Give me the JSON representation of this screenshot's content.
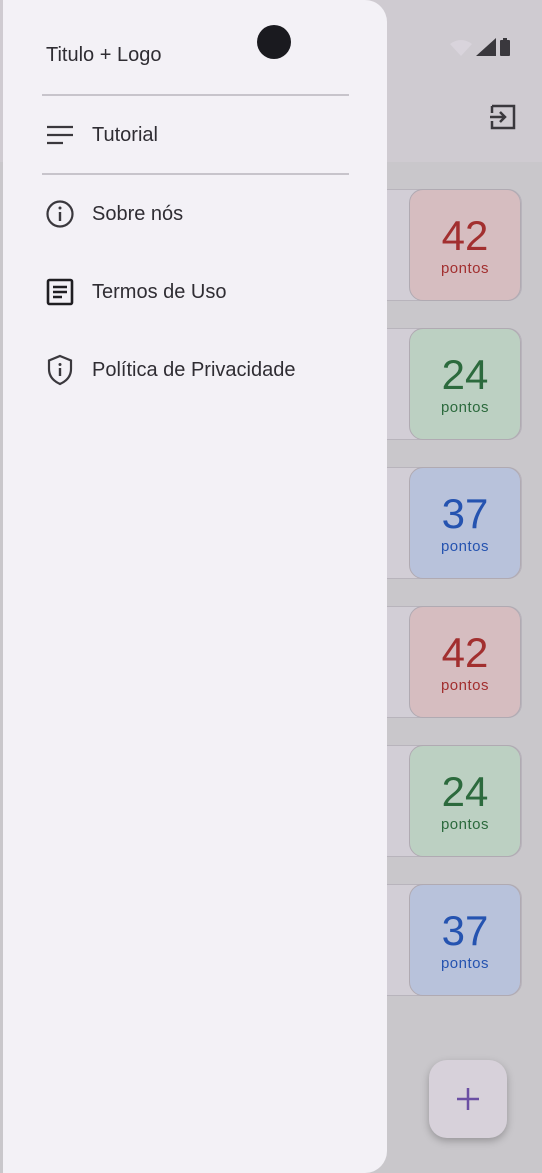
{
  "drawer": {
    "title": "Titulo + Logo",
    "items": [
      {
        "label": "Tutorial",
        "icon": "menu-lines-icon"
      },
      {
        "label": "Sobre nós",
        "icon": "info-icon"
      },
      {
        "label": "Termos de Uso",
        "icon": "document-icon"
      },
      {
        "label": "Política de Privacidade",
        "icon": "shield-info-icon"
      }
    ]
  },
  "cards": [
    {
      "value": "42",
      "unit": "pontos",
      "color": "red"
    },
    {
      "value": "24",
      "unit": "pontos",
      "color": "green"
    },
    {
      "value": "37",
      "unit": "pontos",
      "color": "blue"
    },
    {
      "value": "42",
      "unit": "pontos",
      "color": "red"
    },
    {
      "value": "24",
      "unit": "pontos",
      "color": "green"
    },
    {
      "value": "37",
      "unit": "pontos",
      "color": "blue"
    }
  ],
  "fab": {
    "icon": "plus-icon"
  },
  "appbar": {
    "icon": "logout-icon"
  },
  "colors": {
    "red": "#a22f2f",
    "green": "#2c6a3d",
    "blue": "#2553b0",
    "drawer_bg": "#f3f1f6"
  }
}
